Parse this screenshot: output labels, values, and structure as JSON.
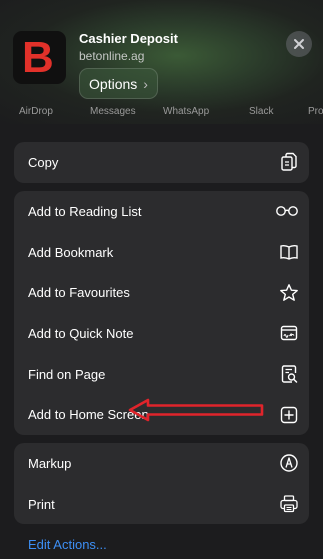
{
  "header": {
    "title": "Cashier Deposit",
    "url": "betonline.ag",
    "options_label": "Options",
    "logo_letter": "B"
  },
  "share_targets": [
    "AirDrop",
    "Messages",
    "WhatsApp",
    "Slack",
    "Pro"
  ],
  "group1": [
    {
      "label": "Copy",
      "icon": "copy-icon"
    }
  ],
  "group2": [
    {
      "label": "Add to Reading List",
      "icon": "glasses-icon"
    },
    {
      "label": "Add Bookmark",
      "icon": "book-icon"
    },
    {
      "label": "Add to Favourites",
      "icon": "star-icon"
    },
    {
      "label": "Add to Quick Note",
      "icon": "quick-note-icon"
    },
    {
      "label": "Find on Page",
      "icon": "find-on-page-icon"
    },
    {
      "label": "Add to Home Screen",
      "icon": "add-square-icon"
    }
  ],
  "group3": [
    {
      "label": "Markup",
      "icon": "markup-icon"
    },
    {
      "label": "Print",
      "icon": "printer-icon"
    }
  ],
  "edit_actions_label": "Edit Actions...",
  "colors": {
    "annotation_arrow": "#e0242b",
    "link": "#3d8ff5"
  }
}
